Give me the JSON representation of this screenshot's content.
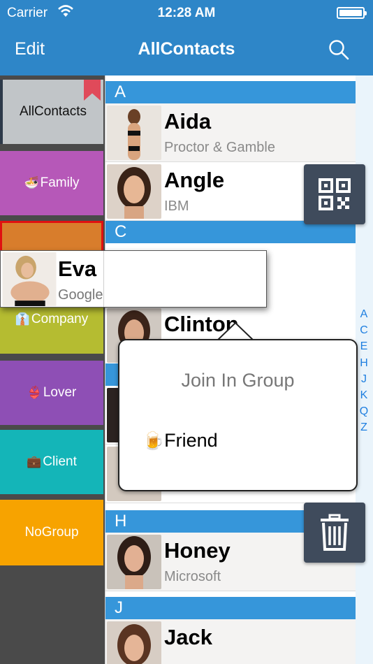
{
  "status": {
    "carrier": "Carrier",
    "time": "12:28 AM"
  },
  "nav": {
    "edit_label": "Edit",
    "title": "AllContacts",
    "search_icon": "search-icon"
  },
  "groups": [
    {
      "label": "AllContacts",
      "emoji": "",
      "color": "#c1c5c8",
      "selected": true
    },
    {
      "label": "Family",
      "emoji": "🍜",
      "color": "#b658b8"
    },
    {
      "label": "Friend",
      "emoji": "🍺",
      "color": "#d87d2c",
      "highlighted": true
    },
    {
      "label": "Company",
      "emoji": "👔",
      "color": "#b5bc31"
    },
    {
      "label": "Lover",
      "emoji": "👙",
      "color": "#8e4fb5"
    },
    {
      "label": "Client",
      "emoji": "💼",
      "color": "#14b5b8"
    },
    {
      "label": "NoGroup",
      "emoji": "",
      "color": "#f7a300"
    }
  ],
  "sections": [
    {
      "letter": "A",
      "contacts": [
        {
          "name": "Aida",
          "company": "Proctor & Gamble"
        },
        {
          "name": "Angle",
          "company": "IBM"
        }
      ]
    },
    {
      "letter": "C",
      "contacts": [
        {
          "name": "Clinton",
          "company": ""
        }
      ]
    },
    {
      "letter": "E",
      "contacts": [
        {
          "name": "Eva",
          "company": "Google"
        }
      ]
    },
    {
      "letter": "H",
      "contacts": [
        {
          "name": "Honey",
          "company": "Microsoft"
        }
      ]
    },
    {
      "letter": "J",
      "contacts": [
        {
          "name": "Jack",
          "company": ""
        }
      ]
    }
  ],
  "dragged_contact": {
    "name": "Eva",
    "company": "Google"
  },
  "index_letters": "A C E H J K Q Z",
  "popover": {
    "title": "Join In Group",
    "option_emoji": "🍺",
    "option_label": "Friend"
  },
  "buttons": {
    "qr": "qr-code-icon",
    "trash": "trash-icon"
  },
  "colors": {
    "nav": "#2e86c8",
    "section": "#3696da",
    "fab": "#3f4b5c",
    "index": "#1f7fe0"
  }
}
